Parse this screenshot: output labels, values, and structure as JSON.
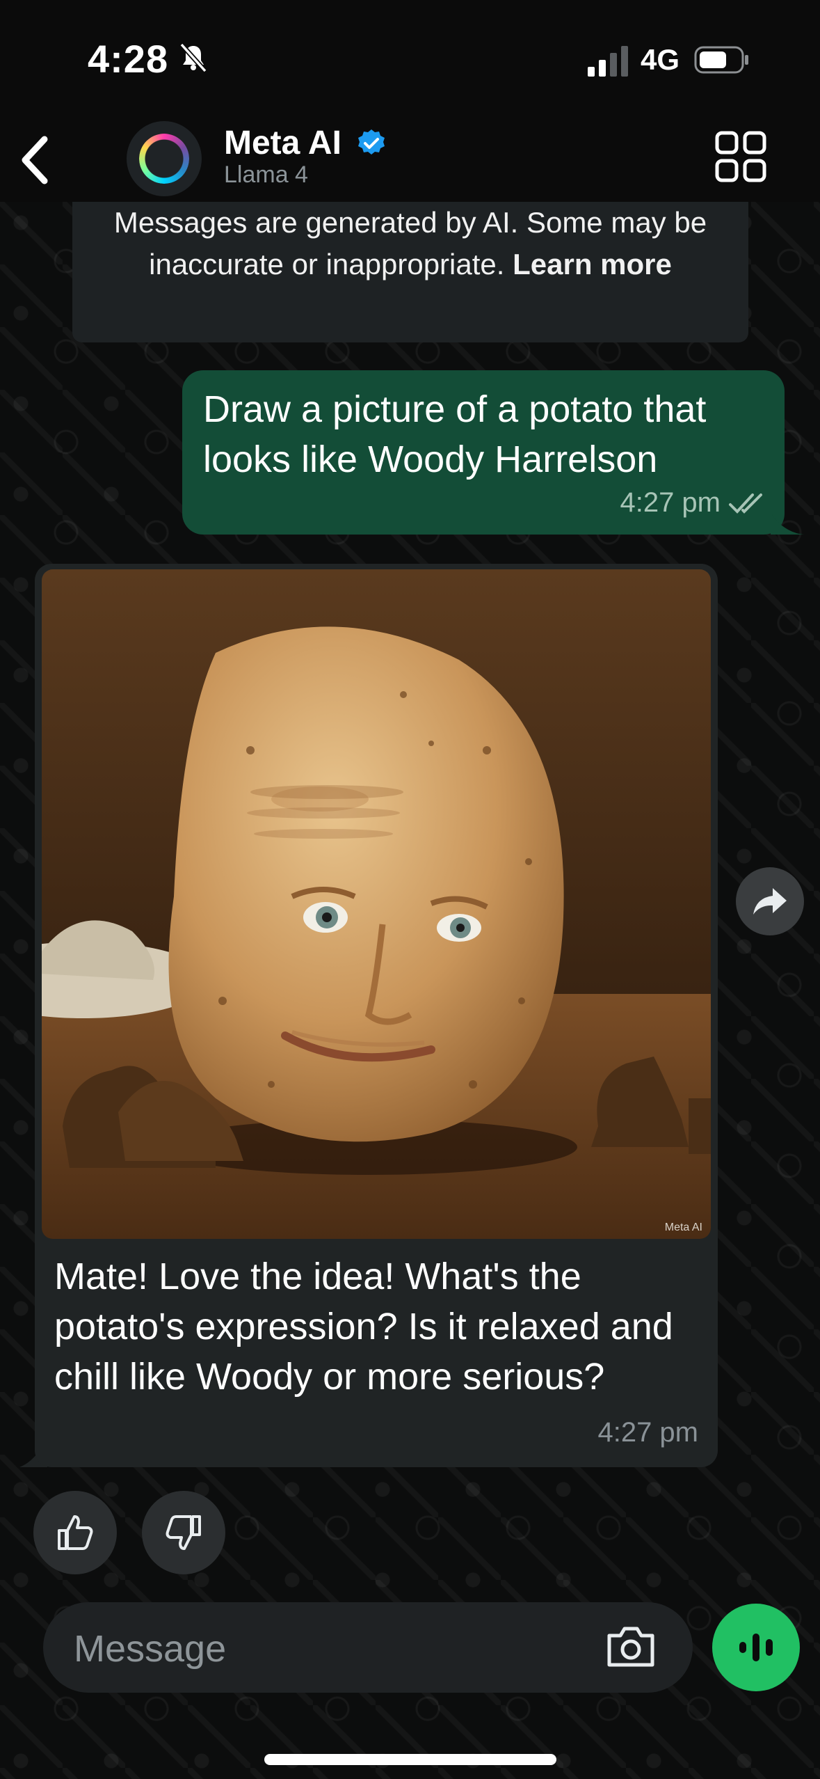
{
  "status_bar": {
    "time": "4:28",
    "network": "4G"
  },
  "header": {
    "title": "Meta AI",
    "subtitle": "Llama 4"
  },
  "notice": {
    "text": "Messages are generated by AI. Some may be inaccurate or inappropriate.",
    "link": "Learn more"
  },
  "messages": {
    "outgoing": {
      "text": "Draw a picture of a potato that looks like Woody Harrelson",
      "time": "4:27 pm"
    },
    "incoming": {
      "text": "Mate! Love the idea! What's the potato's expression? Is it relaxed and chill like Woody or more serious?",
      "time": "4:27 pm",
      "image_watermark": "Meta AI"
    }
  },
  "composer": {
    "placeholder": "Message"
  },
  "colors": {
    "outgoing_bubble": "#134d37",
    "incoming_bubble": "#202425",
    "accent_green": "#21c063",
    "verified_blue": "#1d9bf0"
  },
  "icons": [
    "back-chevron-icon",
    "meta-ai-ring-icon",
    "verified-icon",
    "grid-icon",
    "read-checks-icon",
    "share-icon",
    "thumbs-up-icon",
    "thumbs-down-icon",
    "camera-icon",
    "voice-icon"
  ]
}
